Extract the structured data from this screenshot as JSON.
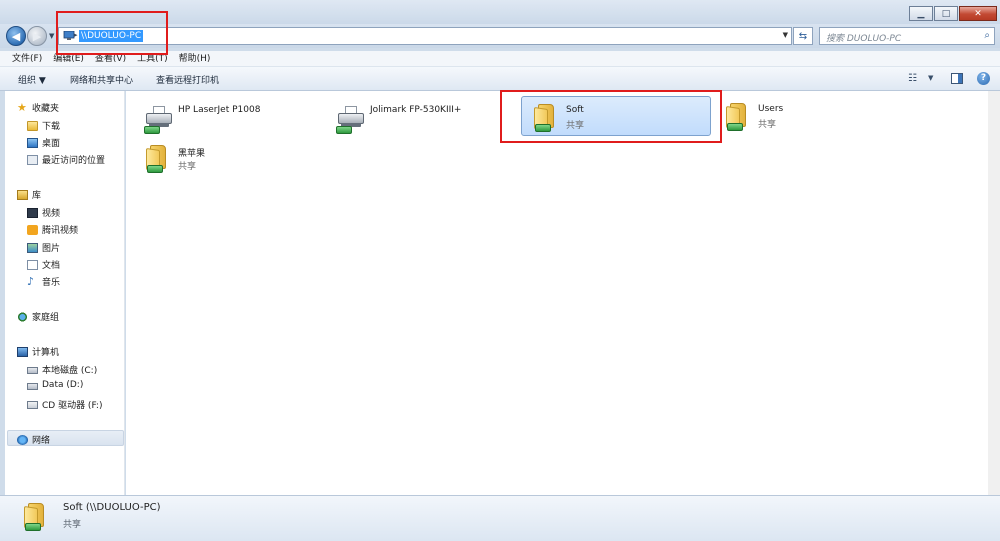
{
  "window": {
    "minimize_glyph": "▁",
    "maximize_glyph": "□",
    "close_glyph": "✕"
  },
  "navigation": {
    "address": "\\\\DUOLUO-PC",
    "search_placeholder": "搜索 DUOLUO-PC"
  },
  "menubar": {
    "items": [
      {
        "label": "文件(F)"
      },
      {
        "label": "编辑(E)"
      },
      {
        "label": "查看(V)"
      },
      {
        "label": "工具(T)"
      },
      {
        "label": "帮助(H)"
      }
    ]
  },
  "toolbar": {
    "organize": "组织 ▼",
    "network_center": "网络和共享中心",
    "remote_printers": "查看远程打印机",
    "help": "?"
  },
  "sidebar": {
    "favorites": {
      "title": "收藏夹",
      "items": [
        {
          "label": "下载"
        },
        {
          "label": "桌面"
        },
        {
          "label": "最近访问的位置"
        }
      ]
    },
    "libraries": {
      "title": "库",
      "items": [
        {
          "label": "视频"
        },
        {
          "label": "腾讯视频"
        },
        {
          "label": "图片"
        },
        {
          "label": "文档"
        },
        {
          "label": "音乐"
        }
      ]
    },
    "homegroup": {
      "title": "家庭组"
    },
    "computer": {
      "title": "计算机",
      "items": [
        {
          "label": "本地磁盘 (C:)"
        },
        {
          "label": "Data (D:)"
        },
        {
          "label": "CD 驱动器 (F:)"
        }
      ]
    },
    "network": {
      "title": "网络"
    }
  },
  "content": {
    "items": [
      {
        "name": "HP LaserJet P1008",
        "subtitle": "",
        "type": "printer",
        "selected": false
      },
      {
        "name": "Jolimark FP-530KIII+",
        "subtitle": "",
        "type": "printer",
        "selected": false
      },
      {
        "name": "Soft",
        "subtitle": "共享",
        "type": "shared-folder",
        "selected": true
      },
      {
        "name": "Users",
        "subtitle": "共享",
        "type": "shared-folder",
        "selected": false
      },
      {
        "name": "黑苹果",
        "subtitle": "共享",
        "type": "shared-folder",
        "selected": false
      }
    ]
  },
  "details": {
    "name": "Soft (\\\\DUOLUO-PC)",
    "subtitle": "共享"
  },
  "colors": {
    "highlight_box": "#e01c1c",
    "selection": "#c1dcfc",
    "address_selection": "#3399ff"
  }
}
